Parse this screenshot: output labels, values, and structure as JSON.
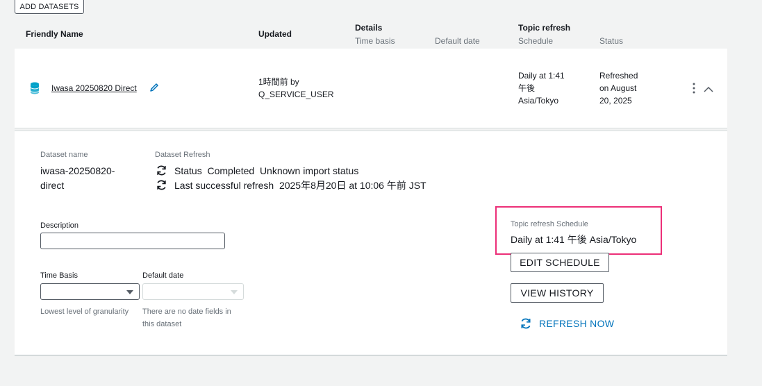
{
  "toolbar": {
    "add_datasets_label": "ADD DATASETS"
  },
  "table": {
    "headers": {
      "friendly_name": "Friendly Name",
      "updated": "Updated",
      "details": "Details",
      "time_basis": "Time basis",
      "default_date": "Default date",
      "topic_refresh": "Topic refresh",
      "schedule": "Schedule",
      "status": "Status"
    },
    "row": {
      "name": "Iwasa 20250820 Direct",
      "updated_line1": "1時間前 by",
      "updated_line2": "Q_SERVICE_USER",
      "schedule_line1": "Daily at 1:41",
      "schedule_line2": "午後",
      "schedule_line3": "Asia/Tokyo",
      "status_line1": "Refreshed",
      "status_line2": "on August",
      "status_line3": "20, 2025"
    }
  },
  "detail": {
    "dataset_name_label": "Dataset name",
    "dataset_name_line1": "iwasa-20250820-",
    "dataset_name_line2": "direct",
    "dataset_refresh_label": "Dataset Refresh",
    "status_line": "Status  Completed  Unknown import status",
    "last_refresh_line": "Last successful refresh  2025年8月20日 at 10:06 午前 JST",
    "description_label": "Description",
    "description_value": "",
    "time_basis_label": "Time Basis",
    "time_basis_help": "Lowest level of granularity",
    "default_date_label": "Default date",
    "default_date_help_line1": "There are no date fields in",
    "default_date_help_line2": "this dataset",
    "topic_schedule_label": "Topic refresh Schedule",
    "topic_schedule_value": "Daily at 1:41 午後 Asia/Tokyo",
    "edit_schedule_label": "EDIT SCHEDULE",
    "view_history_label": "VIEW HISTORY",
    "refresh_now_label": "REFRESH NOW"
  },
  "icons": {
    "database": "database-icon",
    "edit": "pencil-icon",
    "more": "kebab-menu-icon",
    "collapse": "chevron-up-icon",
    "refresh": "refresh-icon"
  },
  "colors": {
    "link": "#0073bb",
    "highlight": "#ec2f78",
    "db_icon": "#00a1c9"
  }
}
